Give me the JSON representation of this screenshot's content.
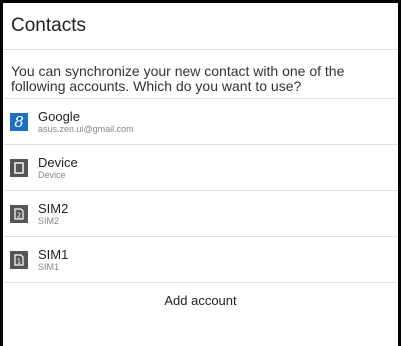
{
  "dialog": {
    "title": "Contacts",
    "message": "You can synchronize your new contact with one of the following accounts. Which do you want to use?",
    "accounts": [
      {
        "name": "Google",
        "detail": "asus.zen.ui@gmail.com",
        "icon": "google-icon",
        "icon_glyph": "8",
        "icon_color": "#1e6fc2"
      },
      {
        "name": "Device",
        "detail": "Device",
        "icon": "phone-device-icon",
        "icon_color": "#555555"
      },
      {
        "name": "SIM2",
        "detail": "SIM2",
        "icon": "sim-card-2-icon",
        "icon_glyph": "2",
        "icon_color": "#555555"
      },
      {
        "name": "SIM1",
        "detail": "SIM1",
        "icon": "sim-card-1-icon",
        "icon_glyph": "1",
        "icon_color": "#555555"
      }
    ],
    "add_account_label": "Add account"
  }
}
